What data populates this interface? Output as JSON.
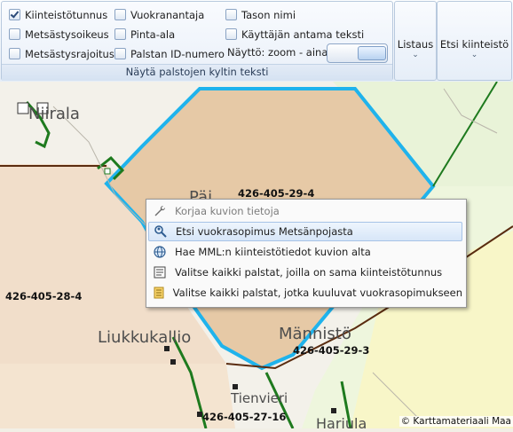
{
  "ribbon": {
    "checkboxes": [
      {
        "label": "Kiinteistötunnus",
        "checked": true
      },
      {
        "label": "Metsästysoikeus",
        "checked": false
      },
      {
        "label": "Metsästysrajoitus",
        "checked": false
      },
      {
        "label": "Vuokranantaja",
        "checked": false
      },
      {
        "label": "Pinta-ala",
        "checked": false
      },
      {
        "label": "Palstan ID-numero",
        "checked": false
      },
      {
        "label": "Tason nimi",
        "checked": false
      },
      {
        "label": "Käyttäjän antama teksti",
        "checked": false
      }
    ],
    "zoom_label": "Näyttö: zoom - aina",
    "group_caption": "Näytä palstojen kyltin teksti",
    "listaus_label": "Listaus",
    "etsi_label": "Etsi kiinteistö",
    "chevron": "⌄"
  },
  "map": {
    "places": {
      "niirala": "Niirala",
      "pai": "Päi",
      "liukkukallio": "Liukkukallio",
      "mannisto": "Männistö",
      "tienvieri": "Tienvieri",
      "hariula": "Hariula"
    },
    "parcels": {
      "p1": "426-405-29-4",
      "p2": "426-405-28-4",
      "p3": "426-405-29-3",
      "p4": "426-405-27-16"
    },
    "copyright": "© Karttamateriaali Maa",
    "colors": {
      "selected_border": "#1fb3ec",
      "parcel_border_green": "#1e7a1e",
      "parcel_border_brown": "#5a2c10",
      "fill_selected": "#e6c9a6",
      "fill_parcel": "#f1deca"
    }
  },
  "context_menu": {
    "items": [
      {
        "label": "Korjaa kuvion tietoja",
        "icon": "wrench-icon",
        "disabled": true
      },
      {
        "label": "Etsi vuokrasopimus Metsänpojasta",
        "icon": "search-person-icon",
        "highlighted": true
      },
      {
        "label": "Hae MML:n kiinteistötiedot kuvion alta",
        "icon": "globe-icon"
      },
      {
        "label": "Valitse kaikki palstat, joilla on sama kiinteistötunnus",
        "icon": "select-list-icon"
      },
      {
        "label": "Valitse kaikki palstat, jotka kuuluvat vuokrasopimukseen",
        "icon": "document-icon"
      }
    ]
  }
}
